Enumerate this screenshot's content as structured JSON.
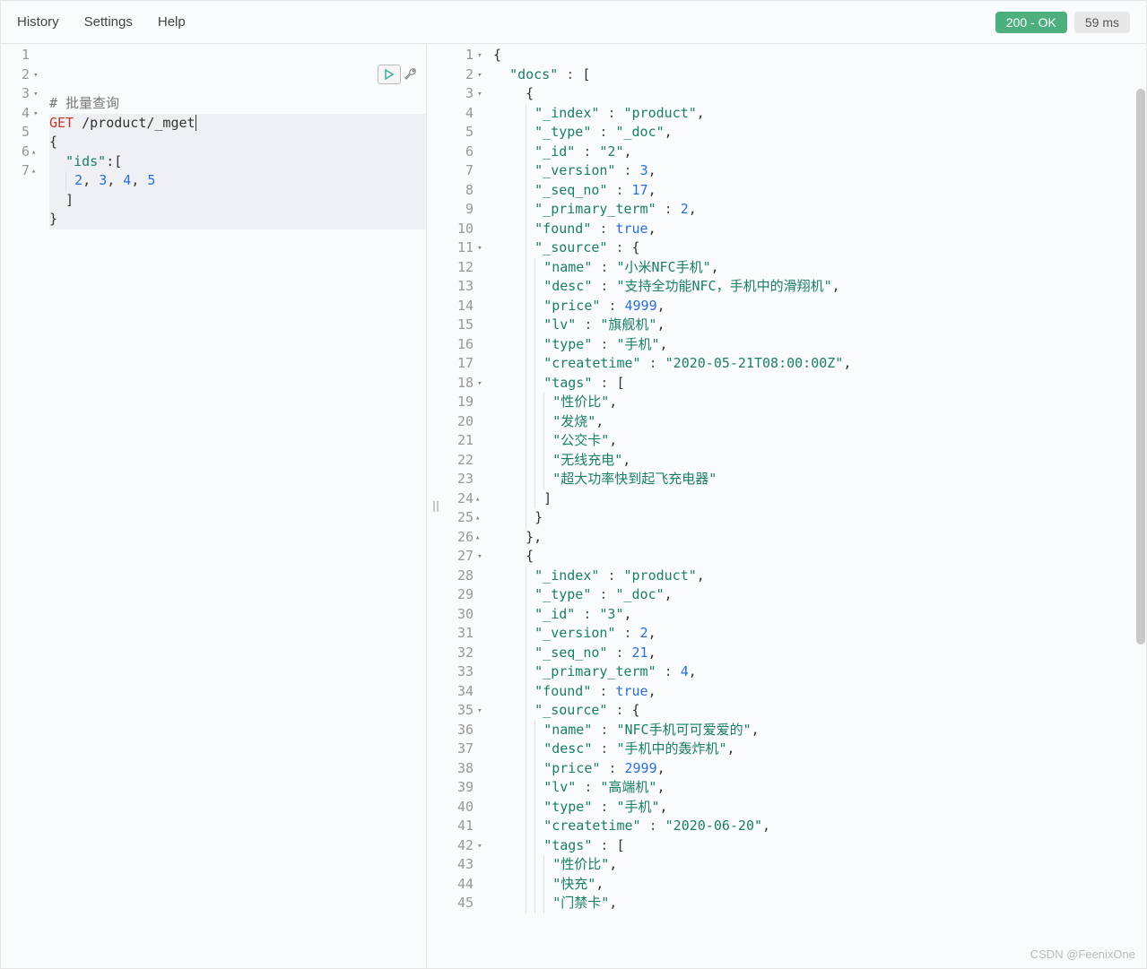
{
  "menu": {
    "history": "History",
    "settings": "Settings",
    "help": "Help"
  },
  "status": {
    "code": "200 - OK",
    "time": "59 ms"
  },
  "watermark": "CSDN @FeenixOne",
  "request": {
    "lines": [
      {
        "n": "1",
        "html": "<span class='tok-comment'># 批量查询</span>"
      },
      {
        "n": "2",
        "fold": "down",
        "hl": true,
        "html": "<span class='tok-method'>GET</span> /product/_mget<span class='active-caret'></span>",
        "run": true
      },
      {
        "n": "3",
        "fold": "down",
        "hl": true,
        "html": "{"
      },
      {
        "n": "4",
        "fold": "down",
        "hl": true,
        "html": "  <span class='tok-key'>\"ids\"</span>:["
      },
      {
        "n": "5",
        "hl": true,
        "html": "  <span class='guide'></span> <span class='tok-num'>2</span>, <span class='tok-num'>3</span>, <span class='tok-num'>4</span>, <span class='tok-num'>5</span>"
      },
      {
        "n": "6",
        "fold": "up",
        "hl": true,
        "html": "  ]"
      },
      {
        "n": "7",
        "fold": "up",
        "hl": true,
        "html": "}"
      }
    ]
  },
  "response": {
    "lines": [
      {
        "n": "1",
        "fold": "down",
        "html": "{"
      },
      {
        "n": "2",
        "fold": "down",
        "html": "  <span class='tok-key'>\"docs\"</span> <span class='tok-punc'>:</span> ["
      },
      {
        "n": "3",
        "fold": "down",
        "html": "    {"
      },
      {
        "n": "4",
        "html": "    <span class='guide'></span> <span class='tok-key'>\"_index\"</span> <span class='tok-punc'>:</span> <span class='tok-str'>\"product\"</span>,"
      },
      {
        "n": "5",
        "html": "    <span class='guide'></span> <span class='tok-key'>\"_type\"</span> <span class='tok-punc'>:</span> <span class='tok-str'>\"_doc\"</span>,"
      },
      {
        "n": "6",
        "html": "    <span class='guide'></span> <span class='tok-key'>\"_id\"</span> <span class='tok-punc'>:</span> <span class='tok-str'>\"2\"</span>,"
      },
      {
        "n": "7",
        "html": "    <span class='guide'></span> <span class='tok-key'>\"_version\"</span> <span class='tok-punc'>:</span> <span class='tok-num'>3</span>,"
      },
      {
        "n": "8",
        "html": "    <span class='guide'></span> <span class='tok-key'>\"_seq_no\"</span> <span class='tok-punc'>:</span> <span class='tok-num'>17</span>,"
      },
      {
        "n": "9",
        "html": "    <span class='guide'></span> <span class='tok-key'>\"_primary_term\"</span> <span class='tok-punc'>:</span> <span class='tok-num'>2</span>,"
      },
      {
        "n": "10",
        "html": "    <span class='guide'></span> <span class='tok-key'>\"found\"</span> <span class='tok-punc'>:</span> <span class='tok-bool'>true</span>,"
      },
      {
        "n": "11",
        "fold": "down",
        "html": "    <span class='guide'></span> <span class='tok-key'>\"_source\"</span> <span class='tok-punc'>:</span> {"
      },
      {
        "n": "12",
        "html": "    <span class='guide'></span> <span class='guide'></span> <span class='tok-key'>\"name\"</span> <span class='tok-punc'>:</span> <span class='tok-str'>\"小米NFC手机\"</span>,"
      },
      {
        "n": "13",
        "html": "    <span class='guide'></span> <span class='guide'></span> <span class='tok-key'>\"desc\"</span> <span class='tok-punc'>:</span> <span class='tok-str'>\"支持全功能NFC，手机中的滑翔机\"</span>,"
      },
      {
        "n": "14",
        "html": "    <span class='guide'></span> <span class='guide'></span> <span class='tok-key'>\"price\"</span> <span class='tok-punc'>:</span> <span class='tok-num'>4999</span>,"
      },
      {
        "n": "15",
        "html": "    <span class='guide'></span> <span class='guide'></span> <span class='tok-key'>\"lv\"</span> <span class='tok-punc'>:</span> <span class='tok-str'>\"旗舰机\"</span>,"
      },
      {
        "n": "16",
        "html": "    <span class='guide'></span> <span class='guide'></span> <span class='tok-key'>\"type\"</span> <span class='tok-punc'>:</span> <span class='tok-str'>\"手机\"</span>,"
      },
      {
        "n": "17",
        "html": "    <span class='guide'></span> <span class='guide'></span> <span class='tok-key'>\"createtime\"</span> <span class='tok-punc'>:</span> <span class='tok-str'>\"2020-05-21T08:00:00Z\"</span>,"
      },
      {
        "n": "18",
        "fold": "down",
        "html": "    <span class='guide'></span> <span class='guide'></span> <span class='tok-key'>\"tags\"</span> <span class='tok-punc'>:</span> ["
      },
      {
        "n": "19",
        "html": "    <span class='guide'></span> <span class='guide'></span> <span class='guide'></span> <span class='tok-str'>\"性价比\"</span>,"
      },
      {
        "n": "20",
        "html": "    <span class='guide'></span> <span class='guide'></span> <span class='guide'></span> <span class='tok-str'>\"发烧\"</span>,"
      },
      {
        "n": "21",
        "html": "    <span class='guide'></span> <span class='guide'></span> <span class='guide'></span> <span class='tok-str'>\"公交卡\"</span>,"
      },
      {
        "n": "22",
        "html": "    <span class='guide'></span> <span class='guide'></span> <span class='guide'></span> <span class='tok-str'>\"无线充电\"</span>,"
      },
      {
        "n": "23",
        "html": "    <span class='guide'></span> <span class='guide'></span> <span class='guide'></span> <span class='tok-str'>\"超大功率快到起飞充电器\"</span>"
      },
      {
        "n": "24",
        "fold": "up",
        "html": "    <span class='guide'></span> <span class='guide'></span> ]"
      },
      {
        "n": "25",
        "fold": "up",
        "html": "    <span class='guide'></span> }"
      },
      {
        "n": "26",
        "fold": "up",
        "html": "    },"
      },
      {
        "n": "27",
        "fold": "down",
        "html": "    {"
      },
      {
        "n": "28",
        "html": "    <span class='guide'></span> <span class='tok-key'>\"_index\"</span> <span class='tok-punc'>:</span> <span class='tok-str'>\"product\"</span>,"
      },
      {
        "n": "29",
        "html": "    <span class='guide'></span> <span class='tok-key'>\"_type\"</span> <span class='tok-punc'>:</span> <span class='tok-str'>\"_doc\"</span>,"
      },
      {
        "n": "30",
        "html": "    <span class='guide'></span> <span class='tok-key'>\"_id\"</span> <span class='tok-punc'>:</span> <span class='tok-str'>\"3\"</span>,"
      },
      {
        "n": "31",
        "html": "    <span class='guide'></span> <span class='tok-key'>\"_version\"</span> <span class='tok-punc'>:</span> <span class='tok-num'>2</span>,"
      },
      {
        "n": "32",
        "html": "    <span class='guide'></span> <span class='tok-key'>\"_seq_no\"</span> <span class='tok-punc'>:</span> <span class='tok-num'>21</span>,"
      },
      {
        "n": "33",
        "html": "    <span class='guide'></span> <span class='tok-key'>\"_primary_term\"</span> <span class='tok-punc'>:</span> <span class='tok-num'>4</span>,"
      },
      {
        "n": "34",
        "html": "    <span class='guide'></span> <span class='tok-key'>\"found\"</span> <span class='tok-punc'>:</span> <span class='tok-bool'>true</span>,"
      },
      {
        "n": "35",
        "fold": "down",
        "html": "    <span class='guide'></span> <span class='tok-key'>\"_source\"</span> <span class='tok-punc'>:</span> {"
      },
      {
        "n": "36",
        "html": "    <span class='guide'></span> <span class='guide'></span> <span class='tok-key'>\"name\"</span> <span class='tok-punc'>:</span> <span class='tok-str'>\"NFC手机可可爱爱的\"</span>,"
      },
      {
        "n": "37",
        "html": "    <span class='guide'></span> <span class='guide'></span> <span class='tok-key'>\"desc\"</span> <span class='tok-punc'>:</span> <span class='tok-str'>\"手机中的轰炸机\"</span>,"
      },
      {
        "n": "38",
        "html": "    <span class='guide'></span> <span class='guide'></span> <span class='tok-key'>\"price\"</span> <span class='tok-punc'>:</span> <span class='tok-num'>2999</span>,"
      },
      {
        "n": "39",
        "html": "    <span class='guide'></span> <span class='guide'></span> <span class='tok-key'>\"lv\"</span> <span class='tok-punc'>:</span> <span class='tok-str'>\"高端机\"</span>,"
      },
      {
        "n": "40",
        "html": "    <span class='guide'></span> <span class='guide'></span> <span class='tok-key'>\"type\"</span> <span class='tok-punc'>:</span> <span class='tok-str'>\"手机\"</span>,"
      },
      {
        "n": "41",
        "html": "    <span class='guide'></span> <span class='guide'></span> <span class='tok-key'>\"createtime\"</span> <span class='tok-punc'>:</span> <span class='tok-str'>\"2020-06-20\"</span>,"
      },
      {
        "n": "42",
        "fold": "down",
        "html": "    <span class='guide'></span> <span class='guide'></span> <span class='tok-key'>\"tags\"</span> <span class='tok-punc'>:</span> ["
      },
      {
        "n": "43",
        "html": "    <span class='guide'></span> <span class='guide'></span> <span class='guide'></span> <span class='tok-str'>\"性价比\"</span>,"
      },
      {
        "n": "44",
        "html": "    <span class='guide'></span> <span class='guide'></span> <span class='guide'></span> <span class='tok-str'>\"快充\"</span>,"
      },
      {
        "n": "45",
        "html": "    <span class='guide'></span> <span class='guide'></span> <span class='guide'></span> <span class='tok-str'>\"门禁卡\"</span>,"
      }
    ]
  }
}
